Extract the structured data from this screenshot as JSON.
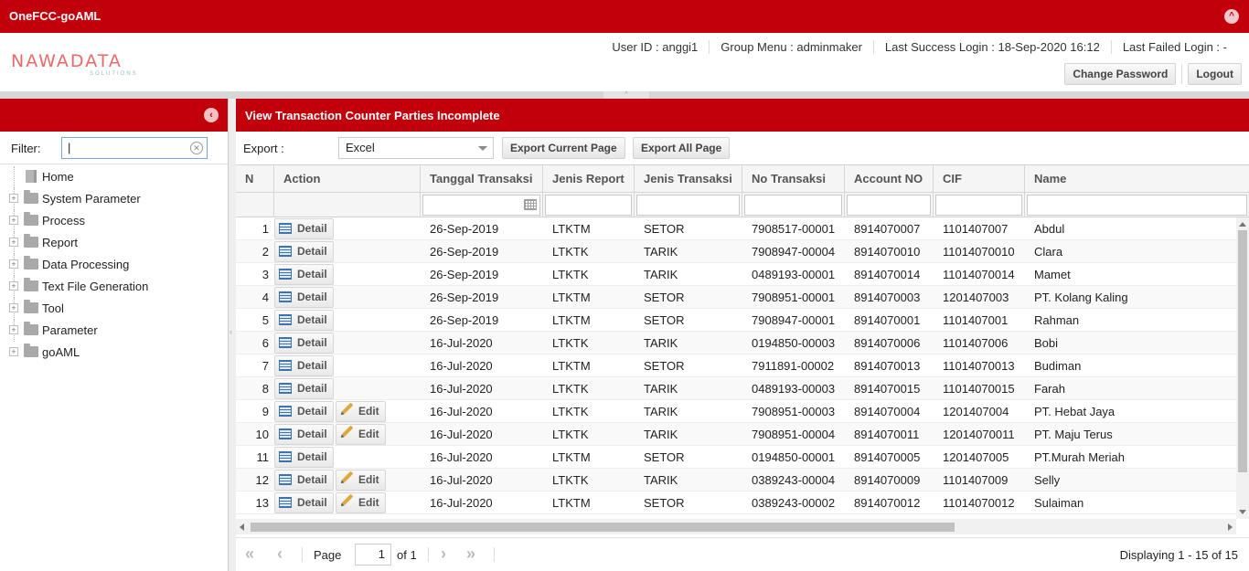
{
  "app": {
    "title": "OneFCC-goAML"
  },
  "logo": {
    "main": "NAWADATA",
    "sub": "SOLUTIONS"
  },
  "userinfo": {
    "user_id": "User ID : anggi1",
    "group_menu": "Group Menu : adminmaker",
    "last_success": "Last Success Login : 18-Sep-2020 16:12",
    "last_failed": "Last Failed Login : -"
  },
  "header_buttons": {
    "change_password": "Change Password",
    "logout": "Logout"
  },
  "sidebar": {
    "filter_label": "Filter:",
    "filter_value": "|",
    "items": [
      {
        "label": "Home"
      },
      {
        "label": "System Parameter"
      },
      {
        "label": "Process"
      },
      {
        "label": "Report"
      },
      {
        "label": "Data Processing"
      },
      {
        "label": "Text File Generation"
      },
      {
        "label": "Tool"
      },
      {
        "label": "Parameter"
      },
      {
        "label": "goAML"
      }
    ]
  },
  "main": {
    "title": "View Transaction Counter Parties Incomplete",
    "export_label": "Export :",
    "export_value": "Excel",
    "export_current": "Export Current Page",
    "export_all": "Export All Page"
  },
  "grid": {
    "columns": [
      "N",
      "Action",
      "Tanggal Transaksi",
      "Jenis Report",
      "Jenis Transaksi",
      "No Transaksi",
      "Account NO",
      "CIF",
      "Name"
    ],
    "detail_label": "Detail",
    "edit_label": "Edit",
    "rows": [
      {
        "n": "1",
        "edit": false,
        "tanggal": "26-Sep-2019",
        "jenis_report": "LTKTM",
        "jenis_transaksi": "SETOR",
        "no_transaksi": "7908517-00001",
        "account_no": "8914070007",
        "cif": "1101407007",
        "name": "Abdul"
      },
      {
        "n": "2",
        "edit": false,
        "tanggal": "26-Sep-2019",
        "jenis_report": "LTKTK",
        "jenis_transaksi": "TARIK",
        "no_transaksi": "7908947-00004",
        "account_no": "8914070010",
        "cif": "11014070010",
        "name": "Clara"
      },
      {
        "n": "3",
        "edit": false,
        "tanggal": "26-Sep-2019",
        "jenis_report": "LTKTK",
        "jenis_transaksi": "TARIK",
        "no_transaksi": "0489193-00001",
        "account_no": "8914070014",
        "cif": "11014070014",
        "name": "Mamet"
      },
      {
        "n": "4",
        "edit": false,
        "tanggal": "26-Sep-2019",
        "jenis_report": "LTKTM",
        "jenis_transaksi": "SETOR",
        "no_transaksi": "7908951-00001",
        "account_no": "8914070003",
        "cif": "1201407003",
        "name": "PT. Kolang Kaling"
      },
      {
        "n": "5",
        "edit": false,
        "tanggal": "26-Sep-2019",
        "jenis_report": "LTKTM",
        "jenis_transaksi": "SETOR",
        "no_transaksi": "7908947-00001",
        "account_no": "8914070001",
        "cif": "1101407001",
        "name": "Rahman"
      },
      {
        "n": "6",
        "edit": false,
        "tanggal": "16-Jul-2020",
        "jenis_report": "LTKTK",
        "jenis_transaksi": "TARIK",
        "no_transaksi": "0194850-00003",
        "account_no": "8914070006",
        "cif": "1101407006",
        "name": "Bobi"
      },
      {
        "n": "7",
        "edit": false,
        "tanggal": "16-Jul-2020",
        "jenis_report": "LTKTM",
        "jenis_transaksi": "SETOR",
        "no_transaksi": "7911891-00002",
        "account_no": "8914070013",
        "cif": "11014070013",
        "name": "Budiman"
      },
      {
        "n": "8",
        "edit": false,
        "tanggal": "16-Jul-2020",
        "jenis_report": "LTKTK",
        "jenis_transaksi": "TARIK",
        "no_transaksi": "0489193-00003",
        "account_no": "8914070015",
        "cif": "11014070015",
        "name": "Farah"
      },
      {
        "n": "9",
        "edit": true,
        "tanggal": "16-Jul-2020",
        "jenis_report": "LTKTK",
        "jenis_transaksi": "TARIK",
        "no_transaksi": "7908951-00003",
        "account_no": "8914070004",
        "cif": "1201407004",
        "name": "PT. Hebat Jaya"
      },
      {
        "n": "10",
        "edit": true,
        "tanggal": "16-Jul-2020",
        "jenis_report": "LTKTK",
        "jenis_transaksi": "TARIK",
        "no_transaksi": "7908951-00004",
        "account_no": "8914070011",
        "cif": "12014070011",
        "name": "PT. Maju Terus"
      },
      {
        "n": "11",
        "edit": false,
        "tanggal": "16-Jul-2020",
        "jenis_report": "LTKTM",
        "jenis_transaksi": "SETOR",
        "no_transaksi": "0194850-00001",
        "account_no": "8914070005",
        "cif": "1201407005",
        "name": "PT.Murah Meriah"
      },
      {
        "n": "12",
        "edit": true,
        "tanggal": "16-Jul-2020",
        "jenis_report": "LTKTK",
        "jenis_transaksi": "TARIK",
        "no_transaksi": "0389243-00004",
        "account_no": "8914070009",
        "cif": "1101407009",
        "name": "Selly"
      },
      {
        "n": "13",
        "edit": true,
        "tanggal": "16-Jul-2020",
        "jenis_report": "LTKTM",
        "jenis_transaksi": "SETOR",
        "no_transaksi": "0389243-00002",
        "account_no": "8914070012",
        "cif": "11014070012",
        "name": "Sulaiman"
      }
    ]
  },
  "pager": {
    "page_label": "Page",
    "page_value": "1",
    "of_label": "of 1",
    "display": "Displaying 1 - 15 of 15"
  },
  "colors": {
    "brand_red": "#c2000b"
  }
}
